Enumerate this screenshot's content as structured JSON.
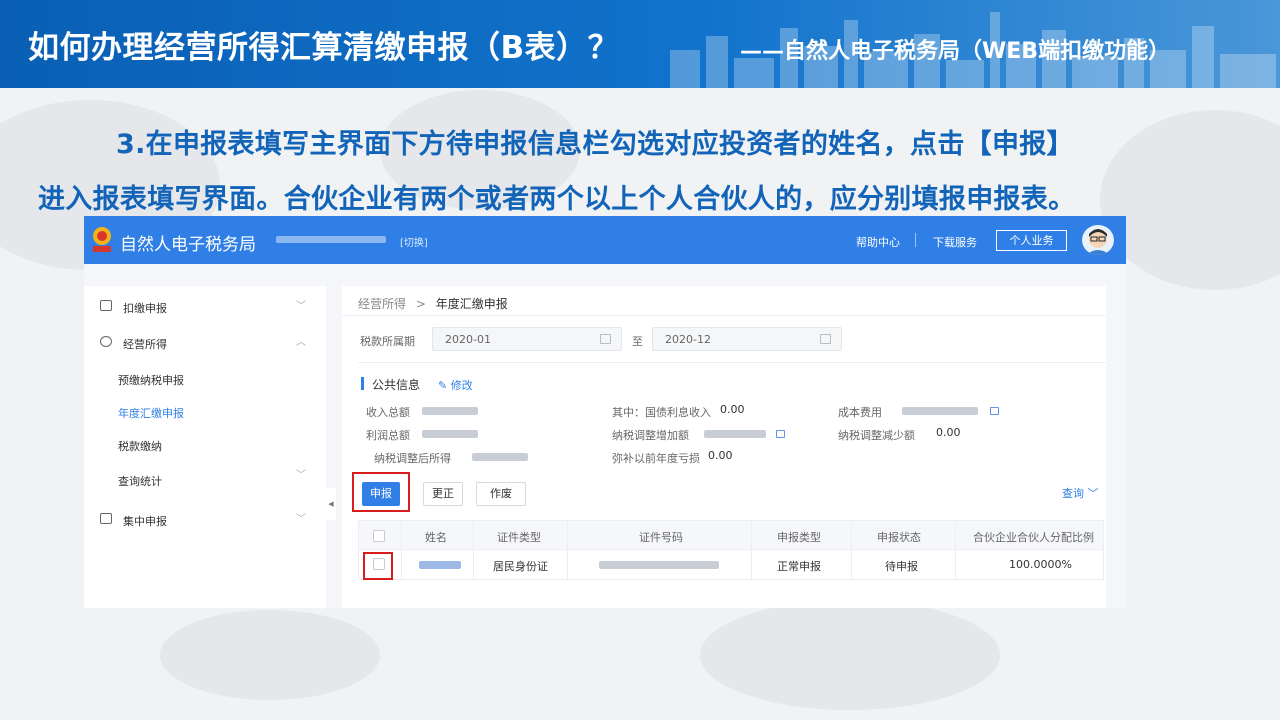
{
  "slide": {
    "title_main": "如何办理经营所得汇算清缴申报（B表）？",
    "title_sub": "——自然人电子税务局（WEB端扣缴功能）",
    "instruction_line1": "3.在申报表填写主界面下方待申报信息栏勾选对应投资者的姓名，点击【申报】",
    "instruction_line2": "进入报表填写界面。合伙企业有两个或者两个以上个人合伙人的，应分别填报申报表。"
  },
  "app": {
    "name": "自然人电子税务局",
    "switch_label": "[切换]",
    "help_label": "帮助中心",
    "download_label": "下载服务",
    "personal_btn": "个人业务"
  },
  "sidebar": {
    "items": [
      {
        "label": "扣缴申报",
        "chevron": "﹀"
      },
      {
        "label": "经营所得",
        "chevron": "︿"
      },
      {
        "label": "集中申报",
        "chevron": "﹀"
      }
    ],
    "subitems": [
      "预缴纳税申报",
      "年度汇缴申报",
      "税款缴纳",
      "查询统计"
    ],
    "subitem_chevron": "﹀"
  },
  "main": {
    "crumb_parent": "经营所得",
    "crumb_sep": ">",
    "crumb_current": "年度汇缴申报",
    "period_label": "税款所属期",
    "period_start": "2020-01",
    "period_to": "至",
    "period_end": "2020-12",
    "public_info_title": "公共信息",
    "edit_label": "修改",
    "info": {
      "income_total_label": "收入总额",
      "treasury_interest_label": "其中：国债利息收入",
      "treasury_interest_value": "0.00",
      "cost_label": "成本费用",
      "profit_total_label": "利润总额",
      "adjust_increase_label": "纳税调整增加额",
      "adjust_decrease_label": "纳税调整减少额",
      "adjust_decrease_value": "0.00",
      "adjusted_income_label": "纳税调整后所得",
      "prior_loss_label": "弥补以前年度亏损",
      "prior_loss_value": "0.00"
    },
    "buttons": {
      "declare": "申报",
      "correct": "更正",
      "void": "作废"
    },
    "query_label": "查询 ﹀",
    "table": {
      "headers": [
        "姓名",
        "证件类型",
        "证件号码",
        "申报类型",
        "申报状态",
        "合伙企业合伙人分配比例"
      ],
      "rows": [
        {
          "id_type": "居民身份证",
          "declare_type": "正常申报",
          "status": "待申报",
          "ratio": "100.0000%"
        }
      ]
    }
  },
  "colors": {
    "title_blue": "#0a5fb4",
    "instruction_blue": "#1264b8",
    "app_blue": "#2f7fe6",
    "highlight_red": "#d71d1d"
  }
}
